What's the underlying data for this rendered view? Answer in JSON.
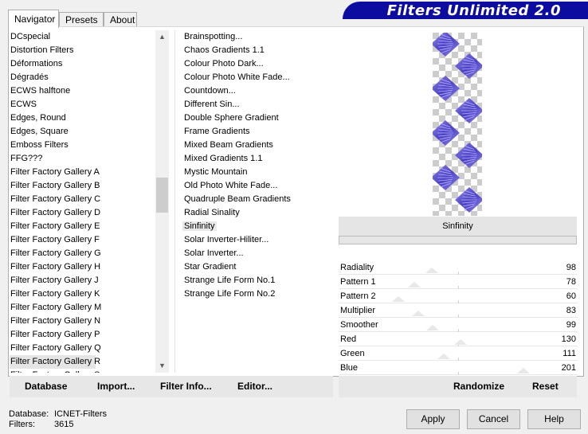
{
  "tabs": [
    "Navigator",
    "Presets",
    "About"
  ],
  "banner": "Filters Unlimited 2.0",
  "categories": [
    "DCspecial",
    "Distortion Filters",
    "Déformations",
    "Dégradés",
    "ECWS halftone",
    "ECWS",
    "Edges, Round",
    "Edges, Square",
    "Emboss Filters",
    "FFG???",
    "Filter Factory Gallery A",
    "Filter Factory Gallery B",
    "Filter Factory Gallery C",
    "Filter Factory Gallery D",
    "Filter Factory Gallery E",
    "Filter Factory Gallery F",
    "Filter Factory Gallery G",
    "Filter Factory Gallery H",
    "Filter Factory Gallery J",
    "Filter Factory Gallery K",
    "Filter Factory Gallery M",
    "Filter Factory Gallery N",
    "Filter Factory Gallery P",
    "Filter Factory Gallery Q",
    "Filter Factory Gallery R",
    "Filter Factory Gallery S"
  ],
  "selected_category": "Filter Factory Gallery R",
  "filters": [
    "Brainspotting...",
    "Chaos Gradients 1.1",
    "Colour Photo Dark...",
    "Colour Photo White Fade...",
    "Countdown...",
    "Different Sin...",
    "Double Sphere Gradient",
    "Frame Gradients",
    "Mixed Beam Gradients",
    "Mixed Gradients 1.1",
    "Mystic Mountain",
    "Old Photo White Fade...",
    "Quadruple Beam Gradients",
    "Radial Sinality",
    "Sinfinity",
    "Solar Inverter-Hiliter...",
    "Solar Inverter...",
    "Star Gradient",
    "Strange Life Form No.1",
    "Strange Life Form No.2"
  ],
  "selected_filter": "Sinfinity",
  "preview_filter_name": "Sinfinity",
  "sliders": [
    {
      "name": "Radiality",
      "value": "98",
      "level": 98
    },
    {
      "name": "Pattern 1",
      "value": "78",
      "level": 78
    },
    {
      "name": "Pattern 2",
      "value": "60",
      "level": 60
    },
    {
      "name": "Multiplier",
      "value": "83",
      "level": 83
    },
    {
      "name": "Smoother",
      "value": "99",
      "level": 99
    },
    {
      "name": "Red",
      "value": "130",
      "level": 130
    },
    {
      "name": "Green",
      "value": "111",
      "level": 111
    },
    {
      "name": "Blue",
      "value": "201",
      "level": 201
    }
  ],
  "bottom_links": {
    "database": "Database",
    "import": "Import...",
    "filter_info": "Filter Info...",
    "editor": "Editor..."
  },
  "randomize": "Randomize",
  "reset": "Reset",
  "db_info": {
    "database_label": "Database:",
    "database_value": "ICNET-Filters",
    "filters_label": "Filters:",
    "filters_value": "3615"
  },
  "buttons": {
    "apply": "Apply",
    "cancel": "Cancel",
    "help": "Help"
  },
  "colors": {
    "banner": "#0c0ca0",
    "preview_blue": "#5a4fd6"
  }
}
